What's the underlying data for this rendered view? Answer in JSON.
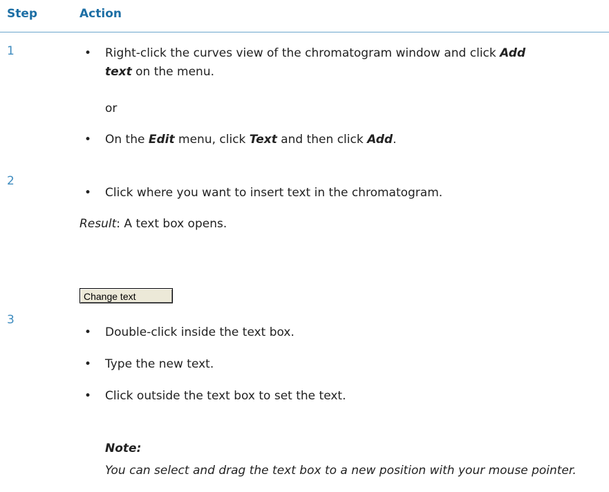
{
  "header": {
    "step_label": "Step",
    "action_label": "Action",
    "rule_color": "#6ba6cc"
  },
  "colors": {
    "heading": "#1d6fa5",
    "step_number": "#3d8bbf",
    "text": "#222222"
  },
  "steps": [
    {
      "number": "1",
      "bullet1": {
        "t1": "Right-click the curves view of the chromatogram window and click ",
        "b1": "Add text",
        "t2": " on the menu."
      },
      "or_text": "or",
      "bullet2": {
        "t1": "On the ",
        "b1": "Edit",
        "t2": " menu, click ",
        "b2": "Text",
        "t3": " and then click ",
        "b3": "Add",
        "t4": "."
      }
    },
    {
      "number": "2",
      "bullet1": "Click where you want to insert text in the chromatogram.",
      "result_label": "Result",
      "result_text": ": A text box opens.",
      "button_label": "Change text"
    },
    {
      "number": "3",
      "bullet1": "Double-click inside the text box.",
      "bullet2": "Type the new text.",
      "bullet3": "Click outside the text box to set the text.",
      "note_heading": "Note:",
      "note_text": "You can select and drag the text box to a new position with your mouse pointer."
    }
  ]
}
